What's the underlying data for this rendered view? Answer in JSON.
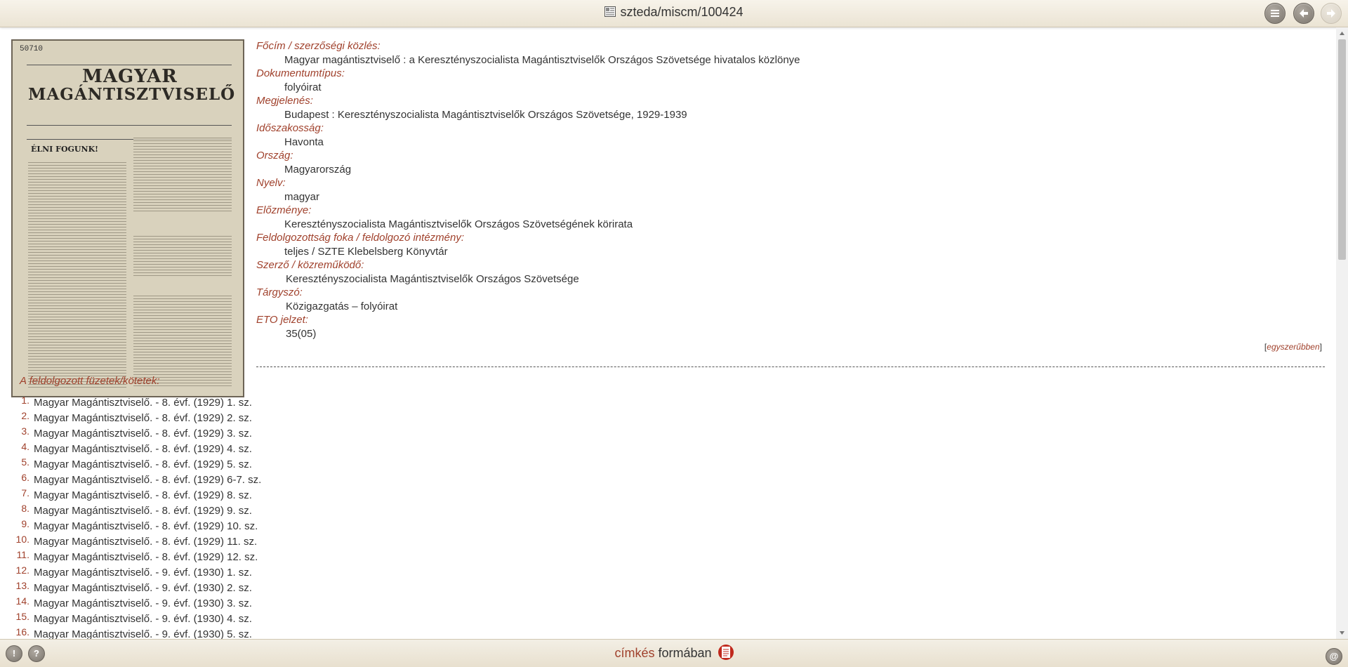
{
  "header": {
    "title": "szteda/miscm/100424",
    "doc_icon": "document-icon",
    "buttons": [
      {
        "name": "list-view-button",
        "icon": "list-icon"
      },
      {
        "name": "back-button",
        "icon": "arrow-left-icon"
      },
      {
        "name": "forward-button",
        "icon": "arrow-right-icon",
        "disabled": true
      }
    ]
  },
  "cover": {
    "number": "50710",
    "masthead_line1": "MAGYAR",
    "masthead_line2": "MAGÁNTISZTVISELŐ",
    "heading": "ÉLNI FOGUNK!"
  },
  "metadata": [
    {
      "label": "Főcím / szerzőségi közlés:",
      "value": "Magyar magántisztviselő : a Keresztényszocialista Magántisztviselők Országos Szövetsége hivatalos közlönye"
    },
    {
      "label": "Dokumentumtípus:",
      "value": "folyóirat"
    },
    {
      "label": "Megjelenés:",
      "value": "Budapest : Keresztényszocialista Magántisztviselők Országos Szövetsége, 1929-1939"
    },
    {
      "label": "Időszakosság:",
      "value": "Havonta"
    },
    {
      "label": "Ország:",
      "value": "Magyarország"
    },
    {
      "label": "Nyelv:",
      "value": "magyar"
    },
    {
      "label": "Előzménye:",
      "value": "Keresztényszocialista Magántisztviselők Országos Szövetségének körirata"
    },
    {
      "label": "Feldolgozottság foka / feldolgozó intézmény:",
      "value": "teljes / SZTE Klebelsberg Könyvtár"
    },
    {
      "label": "Szerző / közreműködő:",
      "value": "Keresztényszocialista Magántisztviselők Országos Szövetsége"
    },
    {
      "label": "Tárgyszó:",
      "value": "Közigazgatás – folyóirat"
    },
    {
      "label": "ETO jelzet:",
      "value": "35(05)"
    }
  ],
  "simpler": {
    "open": "[",
    "link": "egyszerűbben",
    "close": "]"
  },
  "issues_heading": "A feldolgozott füzetek/kötetek:",
  "issues": [
    {
      "num": "1.",
      "text": "Magyar Magántisztviselő. - 8. évf. (1929) 1. sz."
    },
    {
      "num": "2.",
      "text": "Magyar Magántisztviselő. - 8. évf. (1929) 2. sz."
    },
    {
      "num": "3.",
      "text": "Magyar Magántisztviselő. - 8. évf. (1929) 3. sz."
    },
    {
      "num": "4.",
      "text": "Magyar Magántisztviselő. - 8. évf. (1929) 4. sz."
    },
    {
      "num": "5.",
      "text": "Magyar Magántisztviselő. - 8. évf. (1929) 5. sz."
    },
    {
      "num": "6.",
      "text": "Magyar Magántisztviselő. - 8. évf. (1929) 6-7. sz."
    },
    {
      "num": "7.",
      "text": "Magyar Magántisztviselő. - 8. évf. (1929) 8. sz."
    },
    {
      "num": "8.",
      "text": "Magyar Magántisztviselő. - 8. évf. (1929) 9. sz."
    },
    {
      "num": "9.",
      "text": "Magyar Magántisztviselő. - 8. évf. (1929) 10. sz."
    },
    {
      "num": "10.",
      "text": "Magyar Magántisztviselő. - 8. évf. (1929) 11. sz."
    },
    {
      "num": "11.",
      "text": "Magyar Magántisztviselő. - 8. évf. (1929) 12. sz."
    },
    {
      "num": "12.",
      "text": "Magyar Magántisztviselő. - 9. évf. (1930) 1. sz."
    },
    {
      "num": "13.",
      "text": "Magyar Magántisztviselő. - 9. évf. (1930) 2. sz."
    },
    {
      "num": "14.",
      "text": "Magyar Magántisztviselő. - 9. évf. (1930) 3. sz."
    },
    {
      "num": "15.",
      "text": "Magyar Magántisztviselő. - 9. évf. (1930) 4. sz."
    },
    {
      "num": "16.",
      "text": "Magyar Magántisztviselő. - 9. évf. (1930) 5. sz."
    }
  ],
  "footer": {
    "tag_label": "címkés",
    "form_label": "formában",
    "print_icon": "print-icon",
    "left_buttons": [
      {
        "name": "report-button",
        "label": "!"
      },
      {
        "name": "help-button",
        "label": "?"
      }
    ],
    "email_button_label": "@"
  },
  "colors": {
    "label_accent": "#a0412c",
    "text": "#333333",
    "bar_background": "#ebe4d4"
  }
}
